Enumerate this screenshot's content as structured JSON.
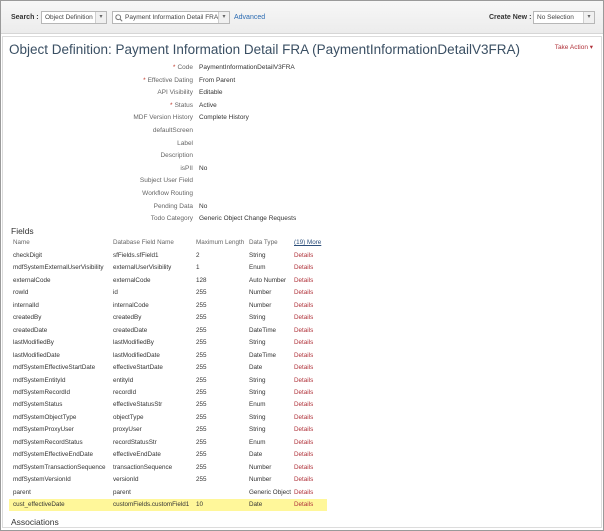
{
  "topbar": {
    "search_label": "Search :",
    "search_type": "Object Definition",
    "search_object": "Payment Information Detail FRA",
    "advanced_link": "Advanced",
    "create_label": "Create New :",
    "create_value": "No Selection"
  },
  "page": {
    "title": "Object Definition: Payment Information Detail FRA (PaymentInformationDetailV3FRA)",
    "take_action": "Take Action ▾"
  },
  "properties": [
    {
      "label": "Code",
      "value": "PaymentInformationDetailV3FRA",
      "required": true
    },
    {
      "label": "Effective Dating",
      "value": "From Parent",
      "required": true
    },
    {
      "label": "API Visibility",
      "value": "Editable",
      "required": false
    },
    {
      "label": "Status",
      "value": "Active",
      "required": true
    },
    {
      "label": "MDF Version History",
      "value": "Complete History",
      "required": false
    },
    {
      "label": "defaultScreen",
      "value": "",
      "required": false
    },
    {
      "label": "Label",
      "value": "",
      "required": false
    },
    {
      "label": "Description",
      "value": "",
      "required": false
    },
    {
      "label": "isPII",
      "value": "No",
      "required": false
    },
    {
      "label": "Subject User Field",
      "value": "",
      "required": false
    },
    {
      "label": "Workflow Routing",
      "value": "",
      "required": false
    },
    {
      "label": "Pending Data",
      "value": "No",
      "required": false
    },
    {
      "label": "Todo Category",
      "value": "Generic Object Change Requests",
      "required": false
    }
  ],
  "fields_section": {
    "heading": "Fields",
    "headers": [
      "Name",
      "Database Field Name",
      "Maximum Length",
      "Data Type",
      "(19) More"
    ],
    "rows": [
      [
        "checkDigit",
        "sfFields.sfField1",
        "2",
        "String",
        "Details"
      ],
      [
        "mdfSystemExternalUserVisibility",
        "externalUserVisibility",
        "1",
        "Enum",
        "Details"
      ],
      [
        "externalCode",
        "externalCode",
        "128",
        "Auto Number",
        "Details"
      ],
      [
        "rowId",
        "id",
        "255",
        "Number",
        "Details"
      ],
      [
        "internalId",
        "internalCode",
        "255",
        "Number",
        "Details"
      ],
      [
        "createdBy",
        "createdBy",
        "255",
        "String",
        "Details"
      ],
      [
        "createdDate",
        "createdDate",
        "255",
        "DateTime",
        "Details"
      ],
      [
        "lastModifiedBy",
        "lastModifiedBy",
        "255",
        "String",
        "Details"
      ],
      [
        "lastModifiedDate",
        "lastModifiedDate",
        "255",
        "DateTime",
        "Details"
      ],
      [
        "mdfSystemEffectiveStartDate",
        "effectiveStartDate",
        "255",
        "Date",
        "Details"
      ],
      [
        "mdfSystemEntityId",
        "entityId",
        "255",
        "String",
        "Details"
      ],
      [
        "mdfSystemRecordId",
        "recordId",
        "255",
        "String",
        "Details"
      ],
      [
        "mdfSystemStatus",
        "effectiveStatusStr",
        "255",
        "Enum",
        "Details"
      ],
      [
        "mdfSystemObjectType",
        "objectType",
        "255",
        "String",
        "Details"
      ],
      [
        "mdfSystemProxyUser",
        "proxyUser",
        "255",
        "String",
        "Details"
      ],
      [
        "mdfSystemRecordStatus",
        "recordStatusStr",
        "255",
        "Enum",
        "Details"
      ],
      [
        "mdfSystemEffectiveEndDate",
        "effectiveEndDate",
        "255",
        "Date",
        "Details"
      ],
      [
        "mdfSystemTransactionSequence",
        "transactionSequence",
        "255",
        "Number",
        "Details"
      ],
      [
        "mdfSystemVersionId",
        "versionId",
        "255",
        "Number",
        "Details"
      ],
      [
        "parent",
        "parent",
        "",
        "Generic Object",
        "Details"
      ],
      [
        "cust_effectiveDate",
        "customFields.customField1",
        "10",
        "Date",
        "Details"
      ]
    ],
    "highlight_row": 20,
    "highlight_color": "#fff79a"
  },
  "associations_section": {
    "heading": "Associations"
  },
  "colors": {
    "link": "#2b6bb2",
    "details": "#b0323a",
    "title": "#3a4f63"
  }
}
